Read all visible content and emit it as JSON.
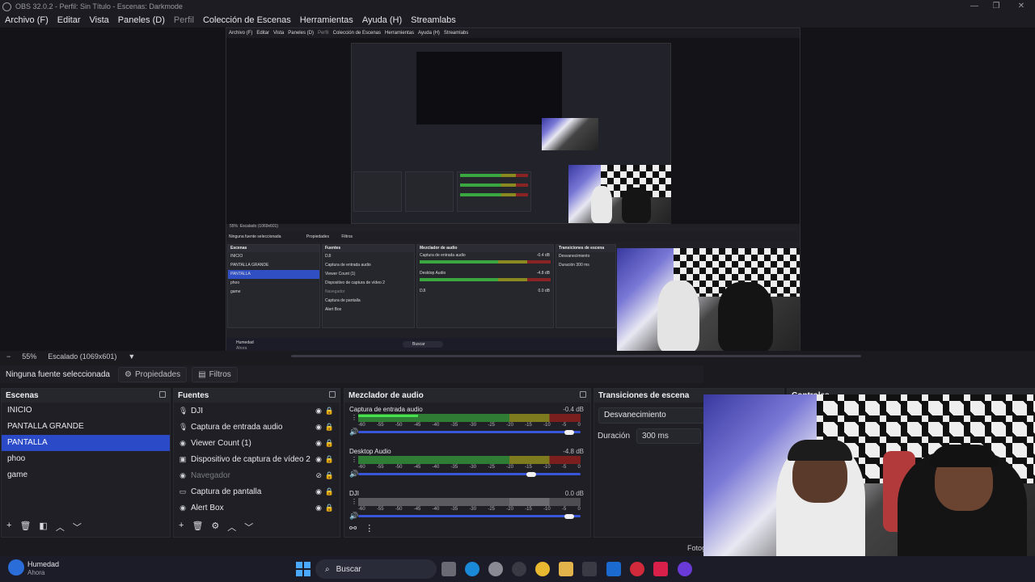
{
  "window": {
    "title": "OBS 32.0.2 - Perfil: Sin Título - Escenas: Darkmode",
    "controls": [
      "—",
      "❐",
      "✕"
    ]
  },
  "menu": [
    "Archivo (F)",
    "Editar",
    "Vista",
    "Paneles (D)",
    "Perfil",
    "Colección de Escenas",
    "Herramientas",
    "Ayuda (H)",
    "Streamlabs"
  ],
  "menu_disabled_index": 4,
  "zoom": {
    "value": "55%",
    "scale_label": "Escalado (1069x601)"
  },
  "source_bar": {
    "no_source": "Ninguna fuente seleccionada",
    "properties": "Propiedades",
    "filters": "Filtros"
  },
  "scenes": {
    "title": "Escenas",
    "items": [
      "INICIO",
      "PANTALLA GRANDE",
      "PANTALLA",
      "phoo",
      "game"
    ],
    "selected": 2
  },
  "sources": {
    "title": "Fuentes",
    "items": [
      {
        "label": "DJI",
        "icon": "mic-icon",
        "visible": true
      },
      {
        "label": "Captura de entrada audio",
        "icon": "mic-icon",
        "visible": true
      },
      {
        "label": "Viewer Count (1)",
        "icon": "globe-icon",
        "visible": true
      },
      {
        "label": "Dispositivo de captura de vídeo 2",
        "icon": "camera-icon",
        "visible": true
      },
      {
        "label": "Navegador",
        "icon": "globe-icon",
        "visible": false
      },
      {
        "label": "Captura de pantalla",
        "icon": "monitor-icon",
        "visible": true
      },
      {
        "label": "Alert Box",
        "icon": "globe-icon",
        "visible": true
      }
    ]
  },
  "mixer": {
    "title": "Mezclador de audio",
    "channels": [
      {
        "name": "Captura de entrada audio",
        "db": "-0.4 dB",
        "level": 0.27,
        "fader": 0.97,
        "grey": false
      },
      {
        "name": "Desktop Audio",
        "db": "-4.8 dB",
        "level": 0.0,
        "fader": 0.8,
        "grey": false
      },
      {
        "name": "DJI",
        "db": "0.0 dB",
        "level": 0.0,
        "fader": 0.97,
        "grey": true
      }
    ],
    "ticks": [
      "-60",
      "-55",
      "-50",
      "-45",
      "-40",
      "-35",
      "-30",
      "-25",
      "-20",
      "-15",
      "-10",
      "-5",
      "0"
    ]
  },
  "transitions": {
    "title": "Transiciones de escena",
    "type": "Desvanecimiento",
    "duration_label": "Duración",
    "duration": "300 ms"
  },
  "controls": {
    "title": "Controles"
  },
  "status": {
    "fps_partial": "Fotog"
  },
  "taskbar": {
    "weather_title": "Humedad",
    "weather_sub": "Ahora",
    "search": "Buscar"
  },
  "inner_capture": {
    "menu": [
      "Archivo (F)",
      "Editar",
      "Vista",
      "Paneles (D)",
      "Perfil",
      "Colección de Escenas",
      "Herramientas",
      "Ayuda (H)",
      "Streamlabs"
    ],
    "zoom": "55%",
    "scale": "Escalado (1069x601)",
    "no_source": "Ninguna fuente seleccionada",
    "properties": "Propiedades",
    "filters": "Filtros",
    "scenes_title": "Escenas",
    "sources_title": "Fuentes",
    "mixer_title": "Mezclador de audio",
    "trans_title": "Transiciones de escena",
    "trans_type": "Desvanecimiento",
    "duration_label": "Duración",
    "duration": "300 ms",
    "mixer_ch1": "Captura de entrada audio",
    "mixer_ch1_db": "-0.4 dB",
    "mixer_ch2": "Desktop Audio",
    "mixer_ch2_db": "-4.8 dB",
    "mixer_ch3": "DJI",
    "mixer_ch3_db": "0.0 dB",
    "weather_title": "Humedad",
    "weather_sub": "Ahora",
    "search": "Buscar"
  },
  "colors": {
    "accent": "#2b4ac8",
    "meter_green": "#2f7d34",
    "meter_yellow": "#7e7a1e",
    "meter_red": "#7b1e1e",
    "fader": "#3a56d8"
  }
}
